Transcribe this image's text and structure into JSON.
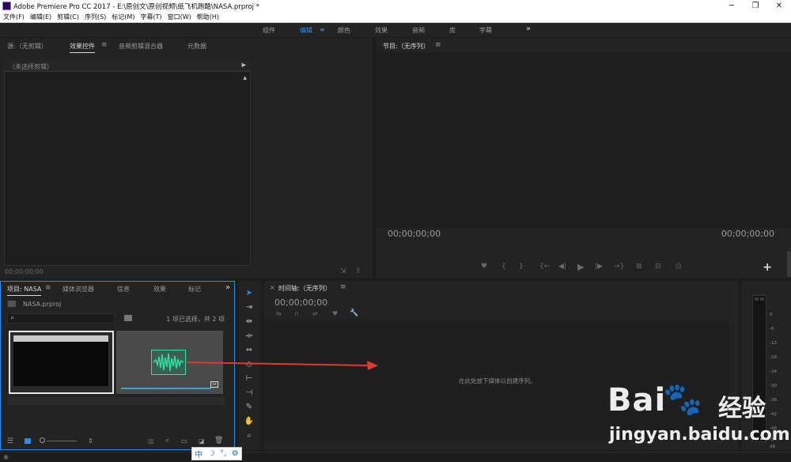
{
  "window": {
    "title": "Adobe Premiere Pro CC 2017 - E:\\原创文\\原创视频\\纸飞机跑酷\\NASA.prproj *",
    "controls": [
      "─",
      "❐",
      "✕"
    ]
  },
  "menu": [
    "文件(F)",
    "编辑(E)",
    "剪辑(C)",
    "序列(S)",
    "标记(M)",
    "字幕(T)",
    "窗口(W)",
    "帮助(H)"
  ],
  "workspaces": {
    "items": [
      "组件",
      "编辑",
      "颜色",
      "效果",
      "音频",
      "库",
      "字幕"
    ],
    "active": "编辑",
    "more": "»"
  },
  "source_panel": {
    "tabs": [
      "源:（无剪辑）",
      "效果控件",
      "音频剪辑混合器",
      "元数据"
    ],
    "active_tab": "效果控件",
    "no_clip": "（未选择剪辑）",
    "timecode": "00;00;00;00"
  },
  "program_panel": {
    "tab": "节目:（无序列）",
    "timecode_left": "00;00;00;00",
    "timecode_right": "00;00;00;00",
    "add_btn": "+"
  },
  "project_panel": {
    "tabs": [
      "项目: NASA",
      "媒体浏览器",
      "信息",
      "效果",
      "标记"
    ],
    "active_tab": "项目: NASA",
    "file_name": "NASA.prproj",
    "search_placeholder": "",
    "selection_status": "1 项已选择，共 2 项",
    "more": "»"
  },
  "timeline_panel": {
    "tab": "时间轴:（无序列）",
    "close": "×",
    "timecode": "00;00;00;00",
    "drop_hint": "在此处放下媒体以创建序列。"
  },
  "meter": {
    "ticks": [
      "0",
      "-6",
      "-12",
      "-18",
      "-24",
      "-30",
      "-36",
      "-42",
      "-48",
      "-54",
      "dB"
    ]
  },
  "ime": [
    "中",
    "☽",
    "°,",
    "⚙"
  ],
  "watermark": {
    "brand_left": "Bai",
    "brand_right": "经验",
    "url": "jingyan.baidu.com"
  },
  "colors": {
    "accent": "#2d8ceb",
    "panel_bg": "#232323",
    "frame_bg": "#1d1d1d",
    "arrow": "#e03a2f",
    "waveform": "#2ee0a0"
  }
}
